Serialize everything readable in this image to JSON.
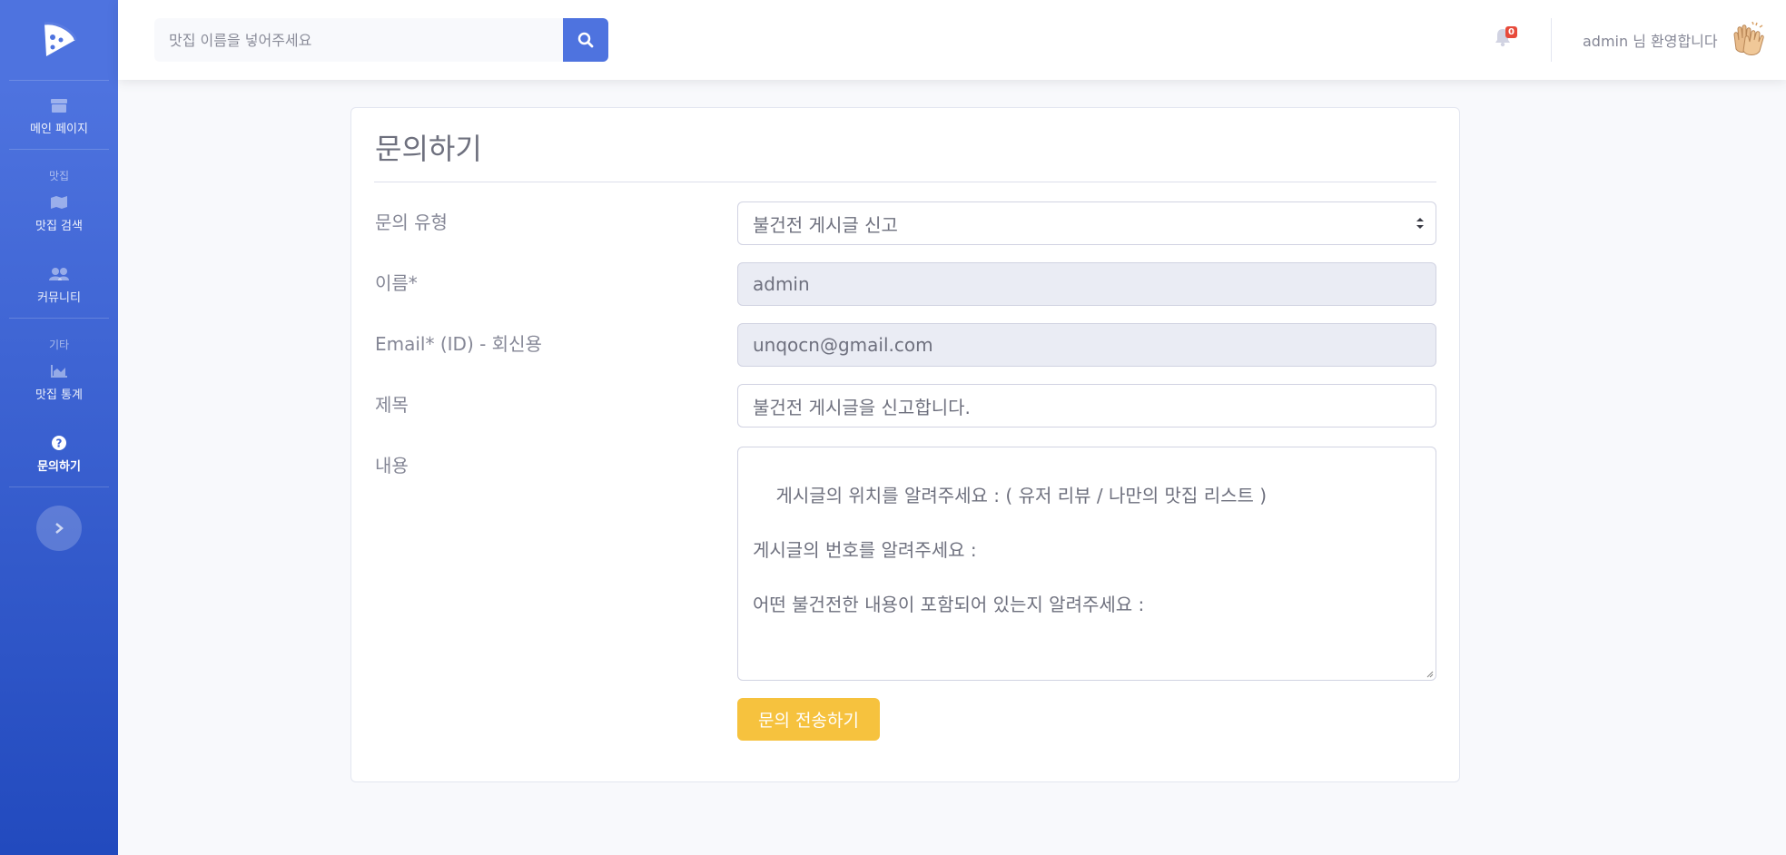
{
  "sidebar": {
    "logo": "pizza-logo-icon",
    "items": [
      {
        "label": "메인 페이지",
        "icon": "store-icon"
      },
      {
        "label": "맛집 검색",
        "icon": "map-icon"
      },
      {
        "label": "커뮤니티",
        "icon": "users-icon"
      },
      {
        "label": "맛집 통계",
        "icon": "chart-area-icon"
      },
      {
        "label": "문의하기",
        "icon": "question-circle-icon",
        "active": true
      }
    ],
    "headings": [
      "맛집",
      "기타"
    ],
    "toggle_icon": "chevron-right-icon"
  },
  "topbar": {
    "search_placeholder": "맛집 이름을 넣어주세요",
    "notification_count": "0",
    "user_greeting": "admin 님 환영합니다",
    "avatar_icon": "clapping-hands-icon"
  },
  "form": {
    "title": "문의하기",
    "type_label": "문의 유형",
    "type_value": "불건전 게시글 신고",
    "name_label": "이름*",
    "name_value": "admin",
    "email_label": "Email* (ID) - 회신용",
    "email_value": "unqocn@gmail.com",
    "subject_label": "제목",
    "subject_value": "불건전 게시글을 신고합니다.",
    "content_label": "내용",
    "content_value": "게시글의 위치를 알려주세요 : ( 유저 리뷰 / 나만의 맛집 리스트 )\n\n게시글의 번호를 알려주세요 :\n\n어떤 불건전한 내용이 포함되어 있는지 알려주세요 :",
    "submit_label": "문의 전송하기"
  },
  "colors": {
    "primary": "#4e73df",
    "warning": "#f6c23e",
    "danger": "#e74a3b"
  }
}
